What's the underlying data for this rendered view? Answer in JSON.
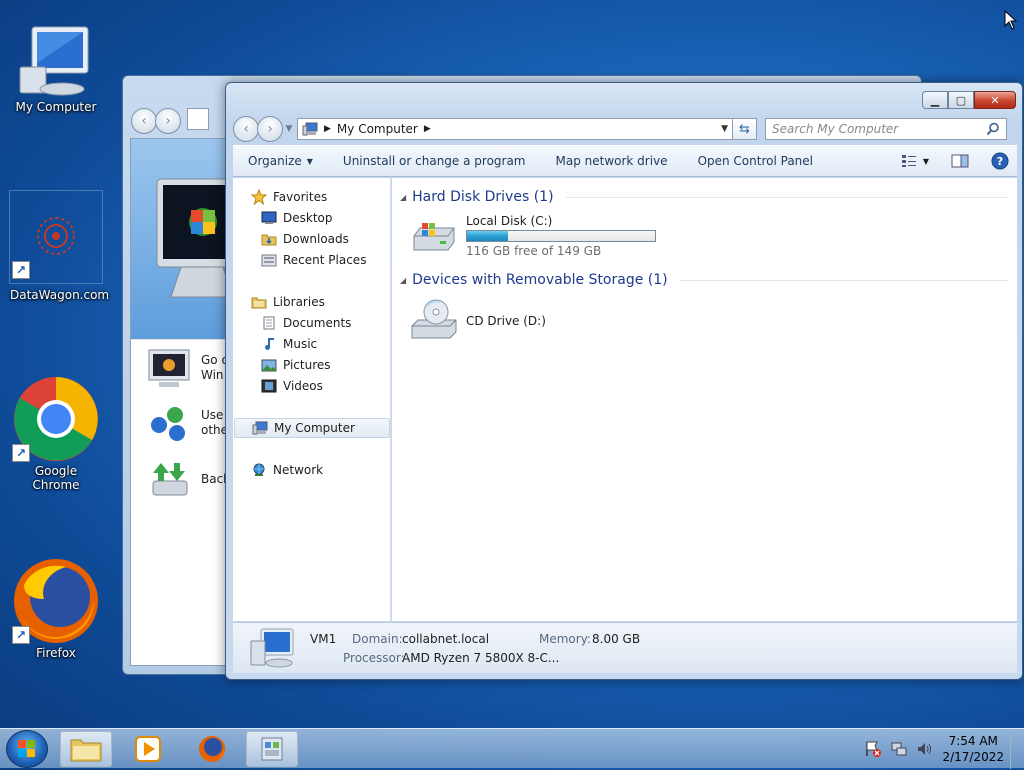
{
  "desktop": {
    "icons": [
      {
        "label": "My Computer"
      },
      {
        "label": "DataWagon.com"
      },
      {
        "label": "Google Chrome"
      },
      {
        "label": "Firefox"
      }
    ]
  },
  "back_window": {
    "items": [
      {
        "text": "Go o\nWin"
      },
      {
        "text": "Use\nothe"
      },
      {
        "text": "Back"
      }
    ]
  },
  "window": {
    "address": {
      "breadcrumb": "My Computer",
      "search_placeholder": "Search My Computer"
    },
    "toolbar": {
      "organize": "Organize",
      "uninstall": "Uninstall or change a program",
      "map_drive": "Map network drive",
      "control_panel": "Open Control Panel"
    },
    "nav": {
      "favorites": "Favorites",
      "desktop": "Desktop",
      "downloads": "Downloads",
      "recent": "Recent Places",
      "libraries": "Libraries",
      "documents": "Documents",
      "music": "Music",
      "pictures": "Pictures",
      "videos": "Videos",
      "computer": "My Computer",
      "network": "Network"
    },
    "content": {
      "hdd_group": "Hard Disk Drives (1)",
      "local_disk": {
        "name": "Local Disk (C:)",
        "free_text": "116 GB free of 149 GB",
        "used_fraction": 0.22
      },
      "removable_group": "Devices with Removable Storage (1)",
      "cd_drive": {
        "name": "CD Drive (D:)"
      }
    },
    "details": {
      "name": "VM1",
      "domain_label": "Domain:",
      "domain_value": "collabnet.local",
      "memory_label": "Memory:",
      "memory_value": "8.00 GB",
      "processor_label": "Processor:",
      "processor_value": "AMD Ryzen 7 5800X 8-C..."
    }
  },
  "taskbar": {
    "time": "7:54 AM",
    "date": "2/17/2022"
  }
}
